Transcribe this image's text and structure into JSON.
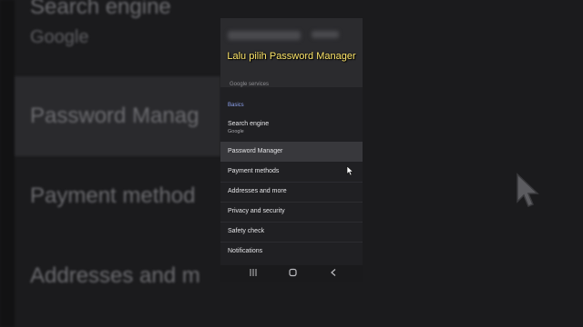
{
  "background": {
    "items": [
      {
        "title": "Search engine",
        "subtitle": "Google"
      },
      {
        "title": "Password Manag"
      },
      {
        "title": "Payment method"
      },
      {
        "title": "Addresses and m"
      }
    ]
  },
  "caption": "Lalu pilih Password Manager",
  "phone": {
    "header_subtitle": "Google services",
    "section_label": "Basics",
    "items": [
      {
        "title": "Search engine",
        "subtitle": "Google"
      },
      {
        "title": "Password Manager"
      },
      {
        "title": "Payment methods"
      },
      {
        "title": "Addresses and more"
      },
      {
        "title": "Privacy and security"
      },
      {
        "title": "Safety check"
      },
      {
        "title": "Notifications"
      }
    ],
    "selected_index": 1
  },
  "navbar": {
    "recents_icon": "recents-icon",
    "home_icon": "home-icon",
    "back_icon": "back-icon"
  },
  "colors": {
    "caption": "#ffe76b",
    "section_label": "#8ea3f0"
  }
}
